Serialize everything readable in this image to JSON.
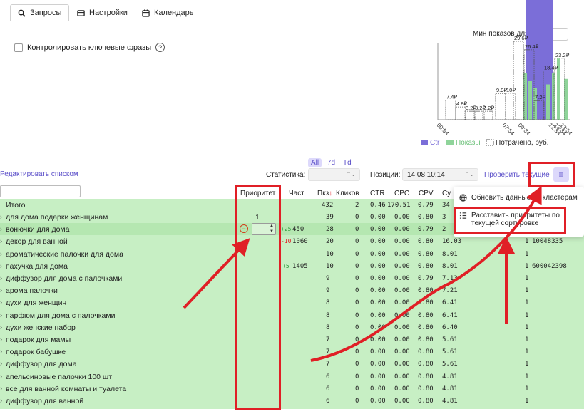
{
  "tabs": [
    {
      "label": "Запросы",
      "icon": "search-icon",
      "active": true
    },
    {
      "label": "Настройки",
      "icon": "settings-icon",
      "active": false
    },
    {
      "label": "Календарь",
      "icon": "calendar-icon",
      "active": false
    }
  ],
  "controls": {
    "checkbox_label": "Контролировать ключевые фразы",
    "help_glyph": "?",
    "min_shows_label": "Мин показов для",
    "min_shows_value": "0"
  },
  "chart_data": {
    "type": "bar",
    "x_tick_labels": [
      "00:54",
      "07:54",
      "09:34",
      "12:34",
      "13:34",
      "13:54"
    ],
    "legend": [
      {
        "name": "Ctr",
        "color": "#7b6ed8"
      },
      {
        "name": "Показы",
        "color": "#8fd49a"
      },
      {
        "name": "Потрачено, руб.",
        "color": "#555555",
        "style": "dashed"
      }
    ],
    "spent_labels": [
      "7.4₽",
      "4.8₽",
      "3.2₽",
      "3.2₽",
      "3.2₽",
      "9.9₽",
      "10₽",
      "29.6₽",
      "26.4₽",
      "18.4₽",
      "7.2₽",
      "23.2₽"
    ],
    "spent_values": [
      7.4,
      4.8,
      3.2,
      3.2,
      3.2,
      9.9,
      10,
      29.6,
      26.4,
      18.4,
      7.2,
      23.2
    ],
    "impressions_relative": [
      0.6,
      0.5,
      0.4,
      0.45,
      0.6,
      0.78,
      0.52
    ],
    "ctr_highlight_color": "#7b6ed8"
  },
  "filters": {
    "edit_link": "Редактировать списком",
    "periods": [
      "All",
      "7d",
      "Td"
    ],
    "active_period": "All",
    "stats_label": "Статистика:",
    "stats_value": "",
    "positions_label": "Позиции:",
    "positions_value": "14.08 10:14",
    "check_link": "Проверить текущие",
    "menu_icon": "menu-icon"
  },
  "table": {
    "headers": {
      "priority": "Приоритет",
      "freq": "Част",
      "shows": "Пкз",
      "sort_glyph": "↓",
      "clicks": "Кликов",
      "ctr": "CTR",
      "cpc": "CPC",
      "cpv": "CPV",
      "sum": "Су"
    },
    "total": {
      "name": "Итого",
      "shows": "432",
      "clicks": "2",
      "ctr": "0.46",
      "cpc": "170.51",
      "cpv": "0.79",
      "sum": "34"
    },
    "rows": [
      {
        "name": "для дома подарки женщинам",
        "priority": "1",
        "chg": "",
        "freq": "",
        "shows": "39",
        "clicks": "0",
        "ctr": "0.00",
        "cpc": "0.00",
        "cpv": "0.80",
        "sum": "3",
        "pos": "",
        "id": ""
      },
      {
        "name": "вонючки для дома",
        "priority": "",
        "chg": "+25",
        "freq": "450",
        "shows": "28",
        "clicks": "0",
        "ctr": "0.00",
        "cpc": "0.00",
        "cpv": "0.79",
        "sum": "2",
        "pos": "",
        "id": ""
      },
      {
        "name": "декор для ванной",
        "priority": "",
        "chg": "-10",
        "freq": "1060",
        "shows": "20",
        "clicks": "0",
        "ctr": "0.00",
        "cpc": "0.00",
        "cpv": "0.80",
        "sum": "16.03",
        "pos": "1",
        "id": "10048335"
      },
      {
        "name": "ароматические палочки для дома",
        "priority": "",
        "chg": "",
        "freq": "",
        "shows": "10",
        "clicks": "0",
        "ctr": "0.00",
        "cpc": "0.00",
        "cpv": "0.80",
        "sum": "8.01",
        "pos": "1",
        "id": ""
      },
      {
        "name": "пахучка для дома",
        "priority": "",
        "chg": "+5",
        "freq": "1405",
        "shows": "10",
        "clicks": "0",
        "ctr": "0.00",
        "cpc": "0.00",
        "cpv": "0.80",
        "sum": "8.01",
        "pos": "1",
        "id": "600042398"
      },
      {
        "name": "диффузор для дома с палочками",
        "priority": "",
        "chg": "",
        "freq": "",
        "shows": "9",
        "clicks": "0",
        "ctr": "0.00",
        "cpc": "0.00",
        "cpv": "0.79",
        "sum": "7.13",
        "pos": "1",
        "id": ""
      },
      {
        "name": "арома палочки",
        "priority": "",
        "chg": "",
        "freq": "",
        "shows": "9",
        "clicks": "0",
        "ctr": "0.00",
        "cpc": "0.00",
        "cpv": "0.80",
        "sum": "7.21",
        "pos": "1",
        "id": ""
      },
      {
        "name": "духи для женщин",
        "priority": "",
        "chg": "",
        "freq": "",
        "shows": "8",
        "clicks": "0",
        "ctr": "0.00",
        "cpc": "0.00",
        "cpv": "0.80",
        "sum": "6.41",
        "pos": "1",
        "id": ""
      },
      {
        "name": "парфюм для дома с палочками",
        "priority": "",
        "chg": "",
        "freq": "",
        "shows": "8",
        "clicks": "0",
        "ctr": "0.00",
        "cpc": "0.00",
        "cpv": "0.80",
        "sum": "6.41",
        "pos": "1",
        "id": ""
      },
      {
        "name": "духи женские набор",
        "priority": "",
        "chg": "",
        "freq": "",
        "shows": "8",
        "clicks": "0",
        "ctr": "0.00",
        "cpc": "0.00",
        "cpv": "0.80",
        "sum": "6.40",
        "pos": "1",
        "id": ""
      },
      {
        "name": "подарок для мамы",
        "priority": "",
        "chg": "",
        "freq": "",
        "shows": "7",
        "clicks": "0",
        "ctr": "0.00",
        "cpc": "0.00",
        "cpv": "0.80",
        "sum": "5.61",
        "pos": "1",
        "id": ""
      },
      {
        "name": "подарок бабушке",
        "priority": "",
        "chg": "",
        "freq": "",
        "shows": "7",
        "clicks": "0",
        "ctr": "0.00",
        "cpc": "0.00",
        "cpv": "0.80",
        "sum": "5.61",
        "pos": "1",
        "id": ""
      },
      {
        "name": "диффузор для дома",
        "priority": "",
        "chg": "",
        "freq": "",
        "shows": "7",
        "clicks": "0",
        "ctr": "0.00",
        "cpc": "0.00",
        "cpv": "0.80",
        "sum": "5.61",
        "pos": "1",
        "id": ""
      },
      {
        "name": "апельсиновые палочки 100 шт",
        "priority": "",
        "chg": "",
        "freq": "",
        "shows": "6",
        "clicks": "0",
        "ctr": "0.00",
        "cpc": "0.00",
        "cpv": "0.80",
        "sum": "4.81",
        "pos": "1",
        "id": ""
      },
      {
        "name": "все для ванной комнаты и туалета",
        "priority": "",
        "chg": "",
        "freq": "",
        "shows": "6",
        "clicks": "0",
        "ctr": "0.00",
        "cpc": "0.00",
        "cpv": "0.80",
        "sum": "4.81",
        "pos": "1",
        "id": ""
      },
      {
        "name": "диффузор для ванной",
        "priority": "",
        "chg": "",
        "freq": "",
        "shows": "6",
        "clicks": "0",
        "ctr": "0.00",
        "cpc": "0.00",
        "cpv": "0.80",
        "sum": "4.81",
        "pos": "1",
        "id": ""
      }
    ]
  },
  "dropdown": {
    "item1": "Обновить данные по кластерам",
    "item2_line1": "Расставить приоритеты по",
    "item2_line2": "текущей сортировке"
  },
  "annotation_color": "#e01f26"
}
